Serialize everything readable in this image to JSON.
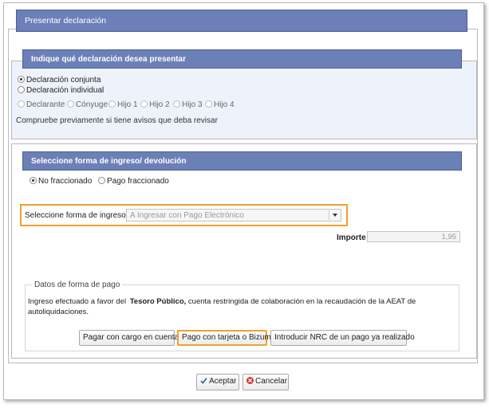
{
  "window": {
    "title": "Presentar declaración"
  },
  "declaration": {
    "header": "Indique qué declaración desea presentar",
    "options": [
      "Declaración conjunta",
      "Declaración individual"
    ],
    "selected": "Declaración conjunta",
    "members": [
      "Declarante",
      "Cónyuge",
      "Hijo 1",
      "Hijo 2",
      "Hijo 3",
      "Hijo 4"
    ],
    "notice": "Compruebe previamente si tiene avisos que deba revisar"
  },
  "payment": {
    "header": "Seleccione forma de ingreso/ devolución",
    "modes": [
      "No fraccionado",
      "Pago fraccionado"
    ],
    "selected_mode": "No fraccionado",
    "form_label": "Seleccione forma de ingreso:",
    "form_value": "A Ingresar con Pago Electrónico",
    "importe_label": "Importe",
    "importe_value": "1,95",
    "details": {
      "legend": "Datos de forma de pago",
      "text_before": "Ingreso efectuado a favor del",
      "text_bold": "Tesoro Público,",
      "text_after": "cuenta restringida de colaboración en la recaudación de la AEAT de autoliquidaciones.",
      "buttons": [
        "Pagar con cargo en cuenta",
        "Pago con tarjeta o Bizum",
        "Introducir NRC de un pago ya realizado"
      ]
    }
  },
  "footer": {
    "accept": "Aceptar",
    "cancel": "Cancelar"
  },
  "colors": {
    "header_bg": "#6d7fb8",
    "highlight": "#f0a030",
    "panel_bg": "#eef2fa"
  }
}
